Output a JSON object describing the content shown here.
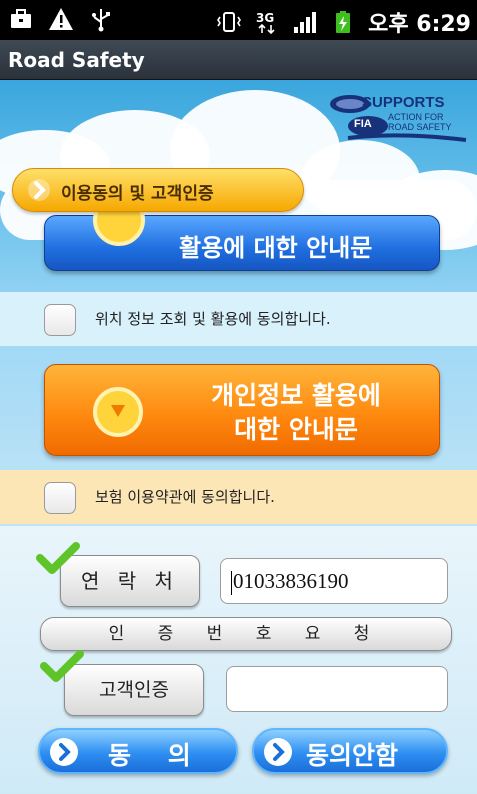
{
  "status_bar": {
    "time": "오후 6:29",
    "network": "3G",
    "icons": [
      "briefcase-icon",
      "warning-icon",
      "usb-icon",
      "vibrate-icon",
      "network-3g-icon",
      "signal-icon",
      "battery-icon"
    ]
  },
  "app_title": "Road Safety",
  "logo": {
    "line1": "SUPPORTS",
    "line2": "ACTION FOR",
    "line3": "ROAD SAFETY",
    "badge": "FIA"
  },
  "section_tab": {
    "label": "이용동의 및 고객인증"
  },
  "location_notice_button": {
    "label": "활용에 대한 안내문"
  },
  "location_consent": {
    "label": "위치 정보 조회 및 활용에 동의합니다."
  },
  "privacy_notice_button": {
    "line1": "개인정보 활용에",
    "line2": "대한 안내문"
  },
  "insurance_consent": {
    "label": "보험 이용약관에 동의합니다."
  },
  "contact": {
    "button_label": "연 락 처",
    "value": "01033836190"
  },
  "request_code_button": {
    "label": "인 증 번 호 요 청"
  },
  "auth": {
    "button_label": "고객인증",
    "value": ""
  },
  "actions": {
    "agree": "동 의",
    "disagree": "동의안함"
  },
  "colors": {
    "accent_orange": "#ff8a10",
    "accent_blue": "#1f6fe0",
    "check_green": "#5fc42a"
  }
}
